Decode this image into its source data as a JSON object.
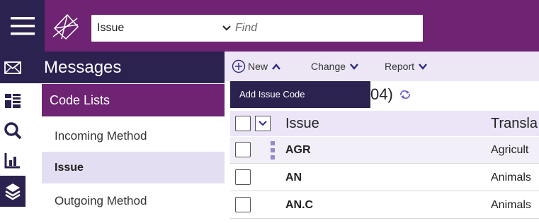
{
  "header": {
    "search_scope": "Issue",
    "find_placeholder": "Find"
  },
  "rail": {
    "icons": [
      "mail-icon",
      "dashboard-icon",
      "search-icon",
      "chart-icon",
      "layers-icon"
    ]
  },
  "sidebar": {
    "title": "Messages",
    "section": "Code Lists",
    "items": [
      {
        "label": "Incoming Method",
        "selected": false
      },
      {
        "label": "Issue",
        "selected": true
      },
      {
        "label": "Outgoing Method",
        "selected": false
      }
    ]
  },
  "toolbar": {
    "new_label": "New",
    "change_label": "Change",
    "report_label": "Report"
  },
  "dropdown": {
    "item_label": "Add Issue Code"
  },
  "list": {
    "count_text": "04)",
    "columns": {
      "issue": "Issue",
      "translation": "Transla"
    },
    "rows": [
      {
        "code": "AGR",
        "translation": "Agricult"
      },
      {
        "code": "AN",
        "translation": "Animals"
      },
      {
        "code": "AN.C",
        "translation": "Animals"
      }
    ]
  },
  "colors": {
    "brand_purple": "#6e2373",
    "dark_navy": "#2c2250",
    "selected_bg": "#e3def2",
    "toolbar_bg": "#ede7f5"
  }
}
